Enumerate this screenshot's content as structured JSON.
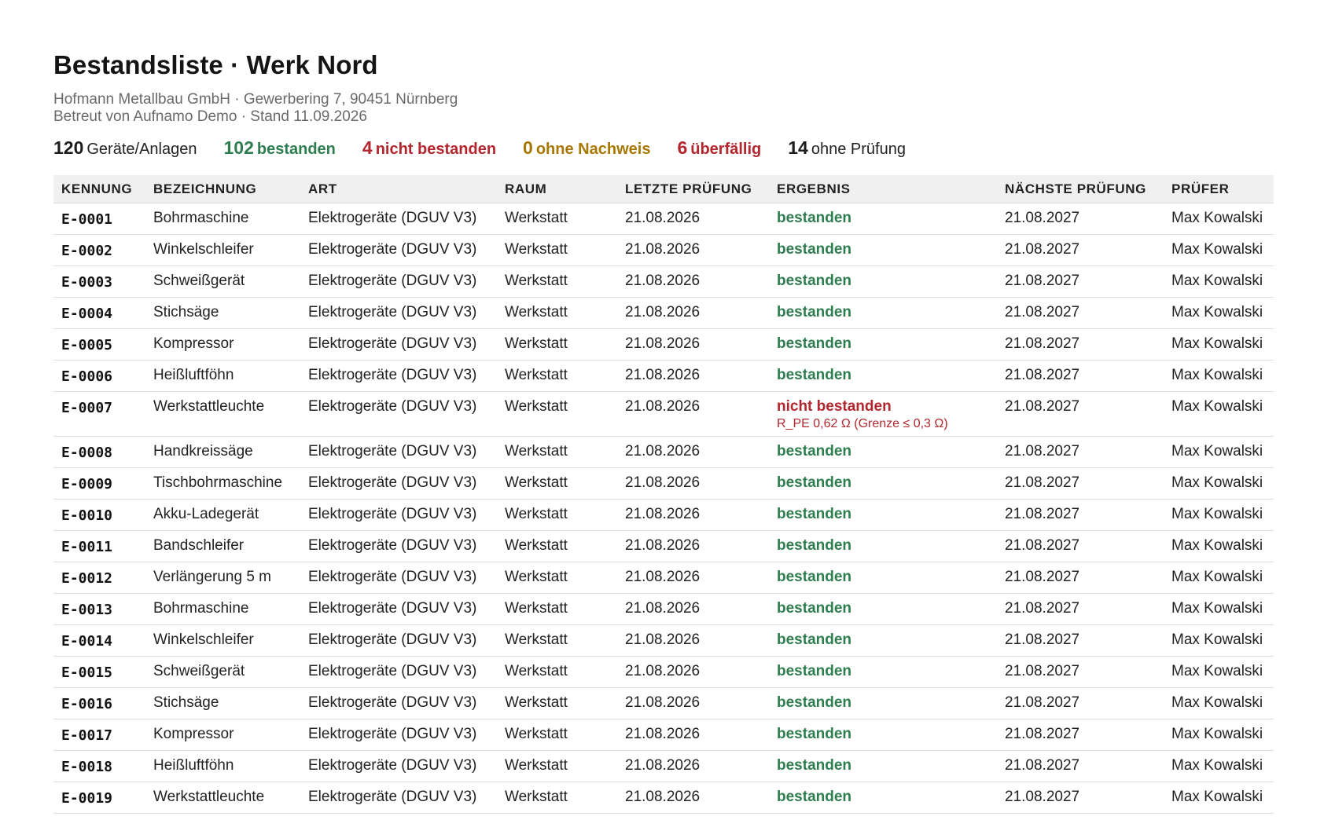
{
  "header": {
    "title": "Bestandsliste · Werk Nord",
    "company": "Hofmann Metallbau GmbH · Gewerbering 7, 90451 Nürnberg",
    "managed_by": "Betreut von Aufnamo Demo · Stand 11.09.2026"
  },
  "stats": [
    {
      "value": "120",
      "label": "Geräte/Anlagen",
      "tone": "total"
    },
    {
      "value": "102",
      "label": "bestanden",
      "tone": "green"
    },
    {
      "value": "4",
      "label": "nicht bestanden",
      "tone": "red"
    },
    {
      "value": "0",
      "label": "ohne Nachweis",
      "tone": "amber"
    },
    {
      "value": "6",
      "label": "überfällig",
      "tone": "red"
    },
    {
      "value": "14",
      "label": "ohne Prüfung",
      "tone": "total"
    }
  ],
  "colors": {
    "green": "#2e7d4f",
    "red": "#b3262d",
    "amber": "#a77700"
  },
  "table": {
    "columns": [
      "KENNUNG",
      "BEZEICHNUNG",
      "ART",
      "RAUM",
      "LETZTE PRÜFUNG",
      "ERGEBNIS",
      "NÄCHSTE PRÜFUNG",
      "PRÜFER"
    ],
    "rows": [
      {
        "id": "E-0001",
        "name": "Bohrmaschine",
        "type": "Elektrogeräte (DGUV V3)",
        "room": "Werkstatt",
        "last": "21.08.2026",
        "result": "bestanden",
        "status": "ok",
        "note": "",
        "next": "21.08.2027",
        "inspector": "Max Kowalski"
      },
      {
        "id": "E-0002",
        "name": "Winkelschleifer",
        "type": "Elektrogeräte (DGUV V3)",
        "room": "Werkstatt",
        "last": "21.08.2026",
        "result": "bestanden",
        "status": "ok",
        "note": "",
        "next": "21.08.2027",
        "inspector": "Max Kowalski"
      },
      {
        "id": "E-0003",
        "name": "Schweißgerät",
        "type": "Elektrogeräte (DGUV V3)",
        "room": "Werkstatt",
        "last": "21.08.2026",
        "result": "bestanden",
        "status": "ok",
        "note": "",
        "next": "21.08.2027",
        "inspector": "Max Kowalski"
      },
      {
        "id": "E-0004",
        "name": "Stichsäge",
        "type": "Elektrogeräte (DGUV V3)",
        "room": "Werkstatt",
        "last": "21.08.2026",
        "result": "bestanden",
        "status": "ok",
        "note": "",
        "next": "21.08.2027",
        "inspector": "Max Kowalski"
      },
      {
        "id": "E-0005",
        "name": "Kompressor",
        "type": "Elektrogeräte (DGUV V3)",
        "room": "Werkstatt",
        "last": "21.08.2026",
        "result": "bestanden",
        "status": "ok",
        "note": "",
        "next": "21.08.2027",
        "inspector": "Max Kowalski"
      },
      {
        "id": "E-0006",
        "name": "Heißluftföhn",
        "type": "Elektrogeräte (DGUV V3)",
        "room": "Werkstatt",
        "last": "21.08.2026",
        "result": "bestanden",
        "status": "ok",
        "note": "",
        "next": "21.08.2027",
        "inspector": "Max Kowalski"
      },
      {
        "id": "E-0007",
        "name": "Werkstattleuchte",
        "type": "Elektrogeräte (DGUV V3)",
        "room": "Werkstatt",
        "last": "21.08.2026",
        "result": "nicht bestanden",
        "status": "bad",
        "note": "R_PE 0,62 Ω (Grenze ≤ 0,3 Ω)",
        "next": "21.08.2027",
        "inspector": "Max Kowalski"
      },
      {
        "id": "E-0008",
        "name": "Handkreissäge",
        "type": "Elektrogeräte (DGUV V3)",
        "room": "Werkstatt",
        "last": "21.08.2026",
        "result": "bestanden",
        "status": "ok",
        "note": "",
        "next": "21.08.2027",
        "inspector": "Max Kowalski"
      },
      {
        "id": "E-0009",
        "name": "Tischbohrmaschine",
        "type": "Elektrogeräte (DGUV V3)",
        "room": "Werkstatt",
        "last": "21.08.2026",
        "result": "bestanden",
        "status": "ok",
        "note": "",
        "next": "21.08.2027",
        "inspector": "Max Kowalski"
      },
      {
        "id": "E-0010",
        "name": "Akku-Ladegerät",
        "type": "Elektrogeräte (DGUV V3)",
        "room": "Werkstatt",
        "last": "21.08.2026",
        "result": "bestanden",
        "status": "ok",
        "note": "",
        "next": "21.08.2027",
        "inspector": "Max Kowalski"
      },
      {
        "id": "E-0011",
        "name": "Bandschleifer",
        "type": "Elektrogeräte (DGUV V3)",
        "room": "Werkstatt",
        "last": "21.08.2026",
        "result": "bestanden",
        "status": "ok",
        "note": "",
        "next": "21.08.2027",
        "inspector": "Max Kowalski"
      },
      {
        "id": "E-0012",
        "name": "Verlängerung 5 m",
        "type": "Elektrogeräte (DGUV V3)",
        "room": "Werkstatt",
        "last": "21.08.2026",
        "result": "bestanden",
        "status": "ok",
        "note": "",
        "next": "21.08.2027",
        "inspector": "Max Kowalski"
      },
      {
        "id": "E-0013",
        "name": "Bohrmaschine",
        "type": "Elektrogeräte (DGUV V3)",
        "room": "Werkstatt",
        "last": "21.08.2026",
        "result": "bestanden",
        "status": "ok",
        "note": "",
        "next": "21.08.2027",
        "inspector": "Max Kowalski"
      },
      {
        "id": "E-0014",
        "name": "Winkelschleifer",
        "type": "Elektrogeräte (DGUV V3)",
        "room": "Werkstatt",
        "last": "21.08.2026",
        "result": "bestanden",
        "status": "ok",
        "note": "",
        "next": "21.08.2027",
        "inspector": "Max Kowalski"
      },
      {
        "id": "E-0015",
        "name": "Schweißgerät",
        "type": "Elektrogeräte (DGUV V3)",
        "room": "Werkstatt",
        "last": "21.08.2026",
        "result": "bestanden",
        "status": "ok",
        "note": "",
        "next": "21.08.2027",
        "inspector": "Max Kowalski"
      },
      {
        "id": "E-0016",
        "name": "Stichsäge",
        "type": "Elektrogeräte (DGUV V3)",
        "room": "Werkstatt",
        "last": "21.08.2026",
        "result": "bestanden",
        "status": "ok",
        "note": "",
        "next": "21.08.2027",
        "inspector": "Max Kowalski"
      },
      {
        "id": "E-0017",
        "name": "Kompressor",
        "type": "Elektrogeräte (DGUV V3)",
        "room": "Werkstatt",
        "last": "21.08.2026",
        "result": "bestanden",
        "status": "ok",
        "note": "",
        "next": "21.08.2027",
        "inspector": "Max Kowalski"
      },
      {
        "id": "E-0018",
        "name": "Heißluftföhn",
        "type": "Elektrogeräte (DGUV V3)",
        "room": "Werkstatt",
        "last": "21.08.2026",
        "result": "bestanden",
        "status": "ok",
        "note": "",
        "next": "21.08.2027",
        "inspector": "Max Kowalski"
      },
      {
        "id": "E-0019",
        "name": "Werkstattleuchte",
        "type": "Elektrogeräte (DGUV V3)",
        "room": "Werkstatt",
        "last": "21.08.2026",
        "result": "bestanden",
        "status": "ok",
        "note": "",
        "next": "21.08.2027",
        "inspector": "Max Kowalski"
      }
    ]
  }
}
